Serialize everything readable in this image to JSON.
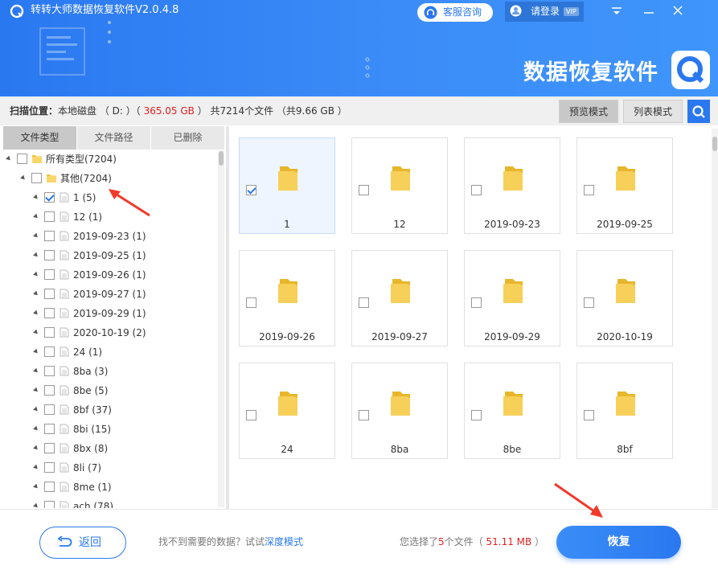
{
  "window": {
    "title": "转转大师数据恢复软件V2.0.4.8",
    "service_label": "客服咨询",
    "login_label": "请登录",
    "vip_badge": "VIP",
    "brand_title": "数据恢复软件"
  },
  "scanbar": {
    "prefix": "扫描位置：",
    "location": "本地磁盘 （ D: ）（ ",
    "disk_size": "365.05 GB",
    "suffix": " ） 共7214个文件 （共9.66 GB ）"
  },
  "modes": {
    "preview": "预览模式",
    "list": "列表模式"
  },
  "tabs": [
    "文件类型",
    "文件路径",
    "已删除"
  ],
  "tree": {
    "root": "所有类型(7204)",
    "other": "其他(7204)",
    "items": [
      {
        "label": "1 (5)",
        "checked": true
      },
      {
        "label": "12 (1)",
        "checked": false
      },
      {
        "label": "2019-09-23 (1)",
        "checked": false
      },
      {
        "label": "2019-09-25 (1)",
        "checked": false
      },
      {
        "label": "2019-09-26 (1)",
        "checked": false
      },
      {
        "label": "2019-09-27 (1)",
        "checked": false
      },
      {
        "label": "2019-09-29 (1)",
        "checked": false
      },
      {
        "label": "2020-10-19 (2)",
        "checked": false
      },
      {
        "label": "24 (1)",
        "checked": false
      },
      {
        "label": "8ba (3)",
        "checked": false
      },
      {
        "label": "8be (5)",
        "checked": false
      },
      {
        "label": "8bf (37)",
        "checked": false
      },
      {
        "label": "8bi (15)",
        "checked": false
      },
      {
        "label": "8bx (8)",
        "checked": false
      },
      {
        "label": "8li (7)",
        "checked": false
      },
      {
        "label": "8me (1)",
        "checked": false
      },
      {
        "label": "ach (78)",
        "checked": false
      }
    ]
  },
  "grid": {
    "folders": [
      {
        "name": "1",
        "checked": true
      },
      {
        "name": "12",
        "checked": false
      },
      {
        "name": "2019-09-23",
        "checked": false
      },
      {
        "name": "2019-09-25",
        "checked": false
      },
      {
        "name": "2019-09-26",
        "checked": false
      },
      {
        "name": "2019-09-27",
        "checked": false
      },
      {
        "name": "2019-09-29",
        "checked": false
      },
      {
        "name": "2020-10-19",
        "checked": false
      },
      {
        "name": "24",
        "checked": false
      },
      {
        "name": "8ba",
        "checked": false
      },
      {
        "name": "8be",
        "checked": false
      },
      {
        "name": "8bf",
        "checked": false
      }
    ]
  },
  "footer": {
    "back_label": "返回",
    "hint_prefix": "找不到需要的数据？试试",
    "hint_link": "深度模式",
    "sel_prefix": "您选择了",
    "sel_count": "5",
    "sel_mid": "个文件（",
    "sel_size": " 51.11 MB ",
    "sel_suffix": "）",
    "recover_label": "恢复"
  },
  "colors": {
    "accent": "#2a78f0",
    "highlight_red": "#e02020"
  }
}
